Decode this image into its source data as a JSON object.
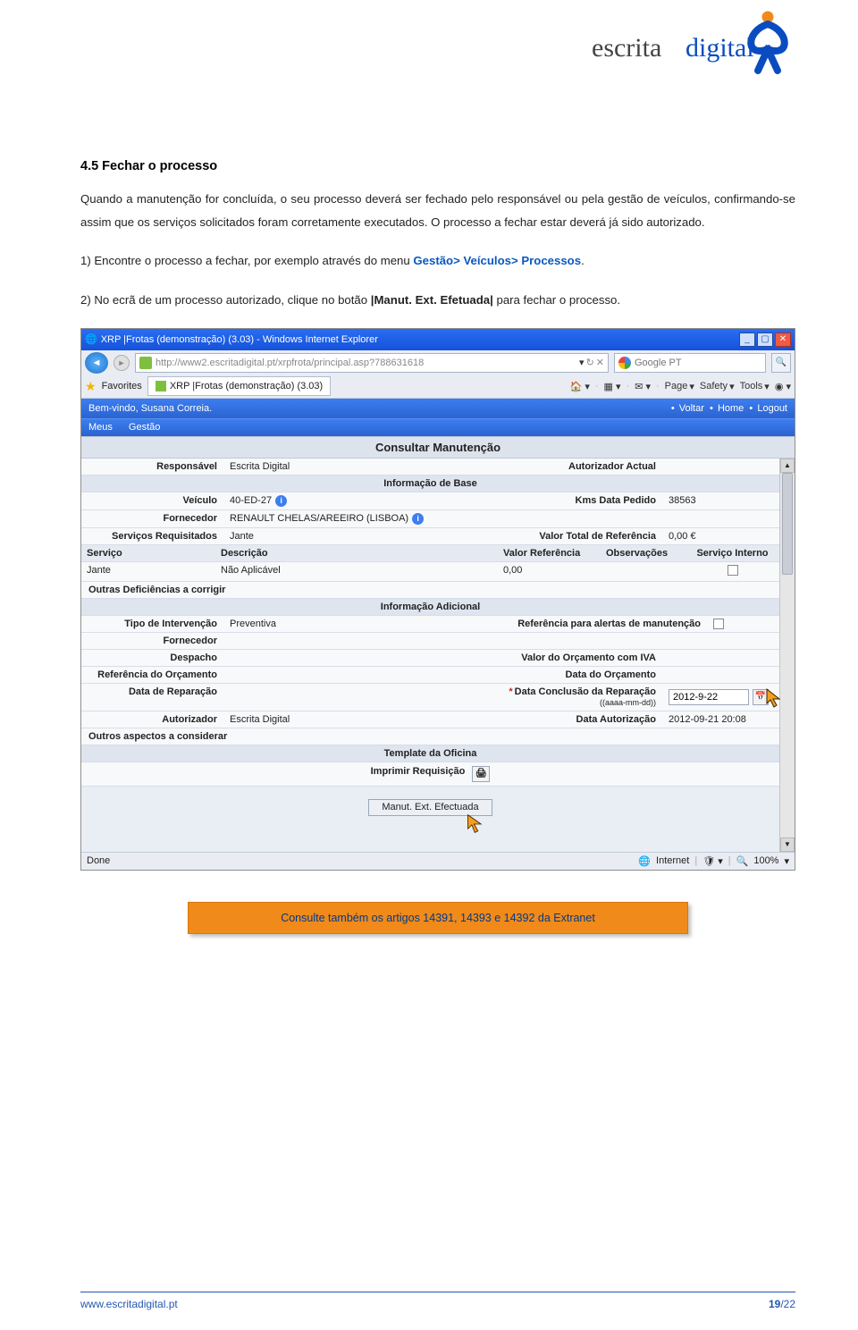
{
  "brand": {
    "word1": "escrita",
    "word2": "digital"
  },
  "heading": "4.5   Fechar o processo",
  "p1": "Quando a manutenção for concluída, o seu processo deverá ser fechado pelo responsável ou pela gestão de veículos, confirmando-se assim que os serviços solicitados foram corretamente executados. O processo a fechar estar deverá já sido autorizado.",
  "p2_a": "1) Encontre o processo a fechar, por exemplo através do menu ",
  "p2_b": "Gestão> Veículos> Processos",
  "p2_c": ".",
  "p3_a": "2) No ecrã de um processo autorizado, clique no botão ",
  "p3_b": "|Manut. Ext. Efetuada|",
  "p3_c": " para fechar o processo.",
  "shot": {
    "window_title": "XRP |Frotas (demonstração) (3.03) - Windows Internet Explorer",
    "url": "http://www2.escritadigital.pt/xrpfrota/principal.asp?788631618",
    "search_placeholder": "Google PT",
    "fav_label": "Favorites",
    "tab_label": "XRP |Frotas (demonstração) (3.03)",
    "cmd": {
      "page": "Page",
      "safety": "Safety",
      "tools": "Tools"
    },
    "welcome": "Bem-vindo, Susana Correia.",
    "actions": {
      "voltar": "Voltar",
      "home": "Home",
      "logout": "Logout"
    },
    "menu": {
      "meus": "Meus",
      "gestao": "Gestão"
    },
    "apptitle": "Consultar Manutenção",
    "fields": {
      "responsavel_l": "Responsável",
      "responsavel_v": "Escrita Digital",
      "autorizador_atual_l": "Autorizador Actual",
      "autorizador_atual_v": "",
      "sec_base": "Informação de Base",
      "veiculo_l": "Veículo",
      "veiculo_v": "40-ED-27",
      "kms_l": "Kms Data Pedido",
      "kms_v": "38563",
      "fornecedor_l": "Fornecedor",
      "fornecedor_v": "RENAULT CHELAS/AREEIRO (LISBOA)",
      "serv_req_l": "Serviços Requisitados",
      "serv_req_v": "Jante",
      "valor_ref_l": "Valor Total de Referência",
      "valor_ref_v": "0,00 €",
      "svc_h1": "Serviço",
      "svc_h2": "Descrição",
      "svc_h3": "Valor Referência",
      "svc_h4": "Observações",
      "svc_h5": "Serviço Interno",
      "svc_v1": "Jante",
      "svc_v2": "Não Aplicável",
      "svc_v3": "0,00",
      "outras_def_l": "Outras Deficiências a corrigir",
      "sec_adic": "Informação Adicional",
      "tipo_int_l": "Tipo de Intervenção",
      "tipo_int_v": "Preventiva",
      "ref_alerta_l": "Referência para alertas de manutenção",
      "fornecedor2_l": "Fornecedor",
      "despacho_l": "Despacho",
      "valor_orc_l": "Valor do Orçamento com IVA",
      "ref_orc_l": "Referência do Orçamento",
      "data_orc_l": "Data do Orçamento",
      "data_rep_l": "Data de Reparação",
      "data_concl_l": "Data Conclusão da Reparação",
      "data_concl_hint": "((aaaa-mm-dd))",
      "data_concl_v": "2012-9-22",
      "autorizador_l": "Autorizador",
      "autorizador_v": "Escrita Digital",
      "data_aut_l": "Data Autorização",
      "data_aut_v": "2012-09-21 20:08",
      "outros_asp_l": "Outros aspectos a considerar",
      "sec_tpl": "Template da Oficina",
      "print_l": "Imprimir Requisição",
      "main_btn": "Manut. Ext. Efectuada"
    },
    "status": {
      "done": "Done",
      "zone": "Internet",
      "zoom": "100%"
    }
  },
  "callout": "Consulte também os artigos 14391, 14393 e 14392 da Extranet",
  "footer": {
    "url": "www.escritadigital.pt",
    "page": "19",
    "total": "/22"
  }
}
